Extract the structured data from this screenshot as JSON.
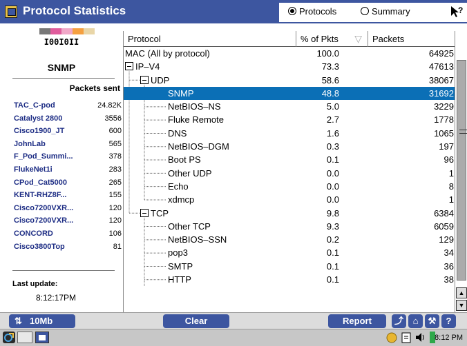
{
  "title": "Protocol Statistics",
  "view_options": [
    {
      "label": "Protocols",
      "selected": true
    },
    {
      "label": "Summary",
      "selected": false
    }
  ],
  "left": {
    "bar_colors": [
      "#777777",
      "#e05c9c",
      "#f0a8c8",
      "#f5a040",
      "#e9d6a8"
    ],
    "code": "I00I0II",
    "protocol": "SNMP",
    "packets_sent_label": "Packets sent",
    "devices": [
      {
        "name": "TAC_C-pod",
        "value": "24.82K"
      },
      {
        "name": "Catalyst 2800",
        "value": "3556"
      },
      {
        "name": "Cisco1900_JT",
        "value": "600"
      },
      {
        "name": "JohnLab",
        "value": "565"
      },
      {
        "name": "F_Pod_Summi...",
        "value": "378"
      },
      {
        "name": "FlukeNet1i",
        "value": "283"
      },
      {
        "name": "CPod_Cat5000",
        "value": "265"
      },
      {
        "name": "KENT-RHZ8F...",
        "value": "155"
      },
      {
        "name": "Cisco7200VXR...",
        "value": "120"
      },
      {
        "name": "Cisco7200VXR...",
        "value": "120"
      },
      {
        "name": "CONCORD",
        "value": "106"
      },
      {
        "name": "Cisco3800Top",
        "value": "81"
      }
    ],
    "last_update_label": "Last update:",
    "last_update": "8:12:17PM"
  },
  "table": {
    "headers": [
      "Protocol",
      "% of Pkts",
      "Packets"
    ],
    "rows": [
      {
        "name": "MAC (All by protocol)",
        "pct": "100.0",
        "packets": "64925",
        "level": 0,
        "expander": false,
        "selected": false
      },
      {
        "name": "IP–V4",
        "pct": "73.3",
        "packets": "47613",
        "level": 0,
        "expander": true,
        "selected": false
      },
      {
        "name": "UDP",
        "pct": "58.6",
        "packets": "38067",
        "level": 1,
        "expander": true,
        "selected": false
      },
      {
        "name": "SNMP",
        "pct": "48.8",
        "packets": "31692",
        "level": 2,
        "expander": false,
        "selected": true
      },
      {
        "name": "NetBIOS–NS",
        "pct": "5.0",
        "packets": "3229",
        "level": 2,
        "expander": false,
        "selected": false
      },
      {
        "name": "Fluke Remote",
        "pct": "2.7",
        "packets": "1778",
        "level": 2,
        "expander": false,
        "selected": false
      },
      {
        "name": "DNS",
        "pct": "1.6",
        "packets": "1065",
        "level": 2,
        "expander": false,
        "selected": false
      },
      {
        "name": "NetBIOS–DGM",
        "pct": "0.3",
        "packets": "197",
        "level": 2,
        "expander": false,
        "selected": false
      },
      {
        "name": "Boot PS",
        "pct": "0.1",
        "packets": "96",
        "level": 2,
        "expander": false,
        "selected": false
      },
      {
        "name": "Other UDP",
        "pct": "0.0",
        "packets": "1",
        "level": 2,
        "expander": false,
        "selected": false
      },
      {
        "name": "Echo",
        "pct": "0.0",
        "packets": "8",
        "level": 2,
        "expander": false,
        "selected": false
      },
      {
        "name": "xdmcp",
        "pct": "0.0",
        "packets": "1",
        "level": 2,
        "expander": false,
        "selected": false
      },
      {
        "name": "TCP",
        "pct": "9.8",
        "packets": "6384",
        "level": 1,
        "expander": true,
        "selected": false
      },
      {
        "name": "Other TCP",
        "pct": "9.3",
        "packets": "6059",
        "level": 2,
        "expander": false,
        "selected": false
      },
      {
        "name": "NetBIOS–SSN",
        "pct": "0.2",
        "packets": "129",
        "level": 2,
        "expander": false,
        "selected": false
      },
      {
        "name": "pop3",
        "pct": "0.1",
        "packets": "34",
        "level": 2,
        "expander": false,
        "selected": false
      },
      {
        "name": "SMTP",
        "pct": "0.1",
        "packets": "36",
        "level": 2,
        "expander": false,
        "selected": false
      },
      {
        "name": "HTTP",
        "pct": "0.1",
        "packets": "38",
        "level": 2,
        "expander": false,
        "selected": false
      }
    ]
  },
  "commands": {
    "bandwidth": "10Mb",
    "clear": "Clear",
    "report": "Report"
  },
  "taskbar": {
    "time": "8:12 PM"
  },
  "colors": {
    "title_bar": "#3d56a0",
    "selection": "#0b6fb6",
    "device_text": "#1c2c84"
  }
}
